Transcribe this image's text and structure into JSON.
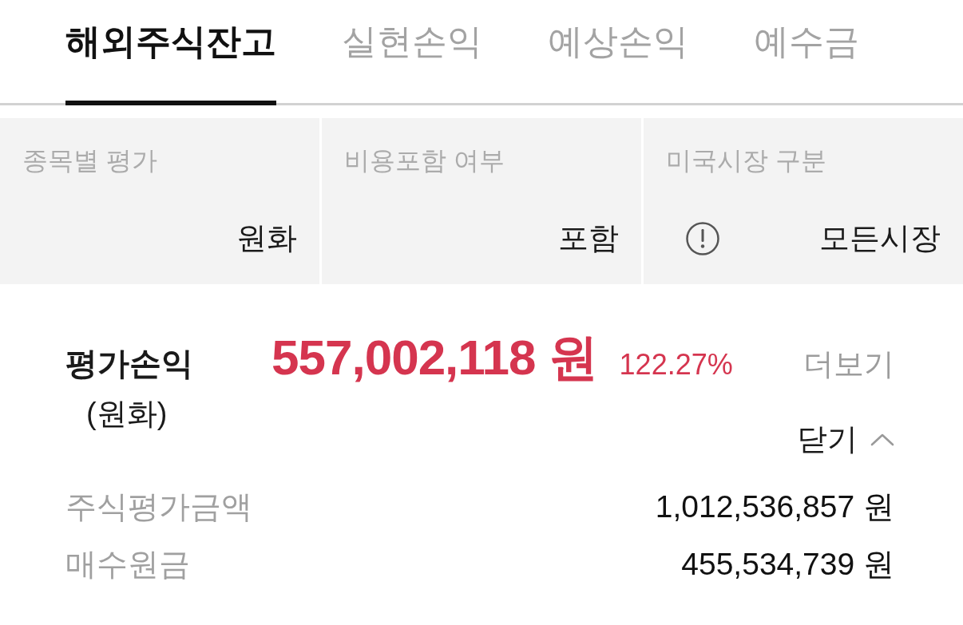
{
  "tabs": [
    {
      "label": "해외주식잔고",
      "selected": true
    },
    {
      "label": "실현손익",
      "selected": false
    },
    {
      "label": "예상손익",
      "selected": false
    },
    {
      "label": "예수금",
      "selected": false
    }
  ],
  "filters": [
    {
      "label": "종목별 평가",
      "value": "원화",
      "info_icon": false
    },
    {
      "label": "비용포함 여부",
      "value": "포함",
      "info_icon": false
    },
    {
      "label": "미국시장 구분",
      "value": "모든시장",
      "info_icon": true
    }
  ],
  "summary": {
    "title": "평가손익",
    "subtitle": "(원화)",
    "amount": "557,002,118 원",
    "rate": "122.27%",
    "more_link": "더보기",
    "collapse_button": "닫기",
    "expanded": true
  },
  "details": [
    {
      "label": "주식평가금액",
      "value": "1,012,536,857 원"
    },
    {
      "label": "매수원금",
      "value": "455,534,739 원"
    }
  ]
}
